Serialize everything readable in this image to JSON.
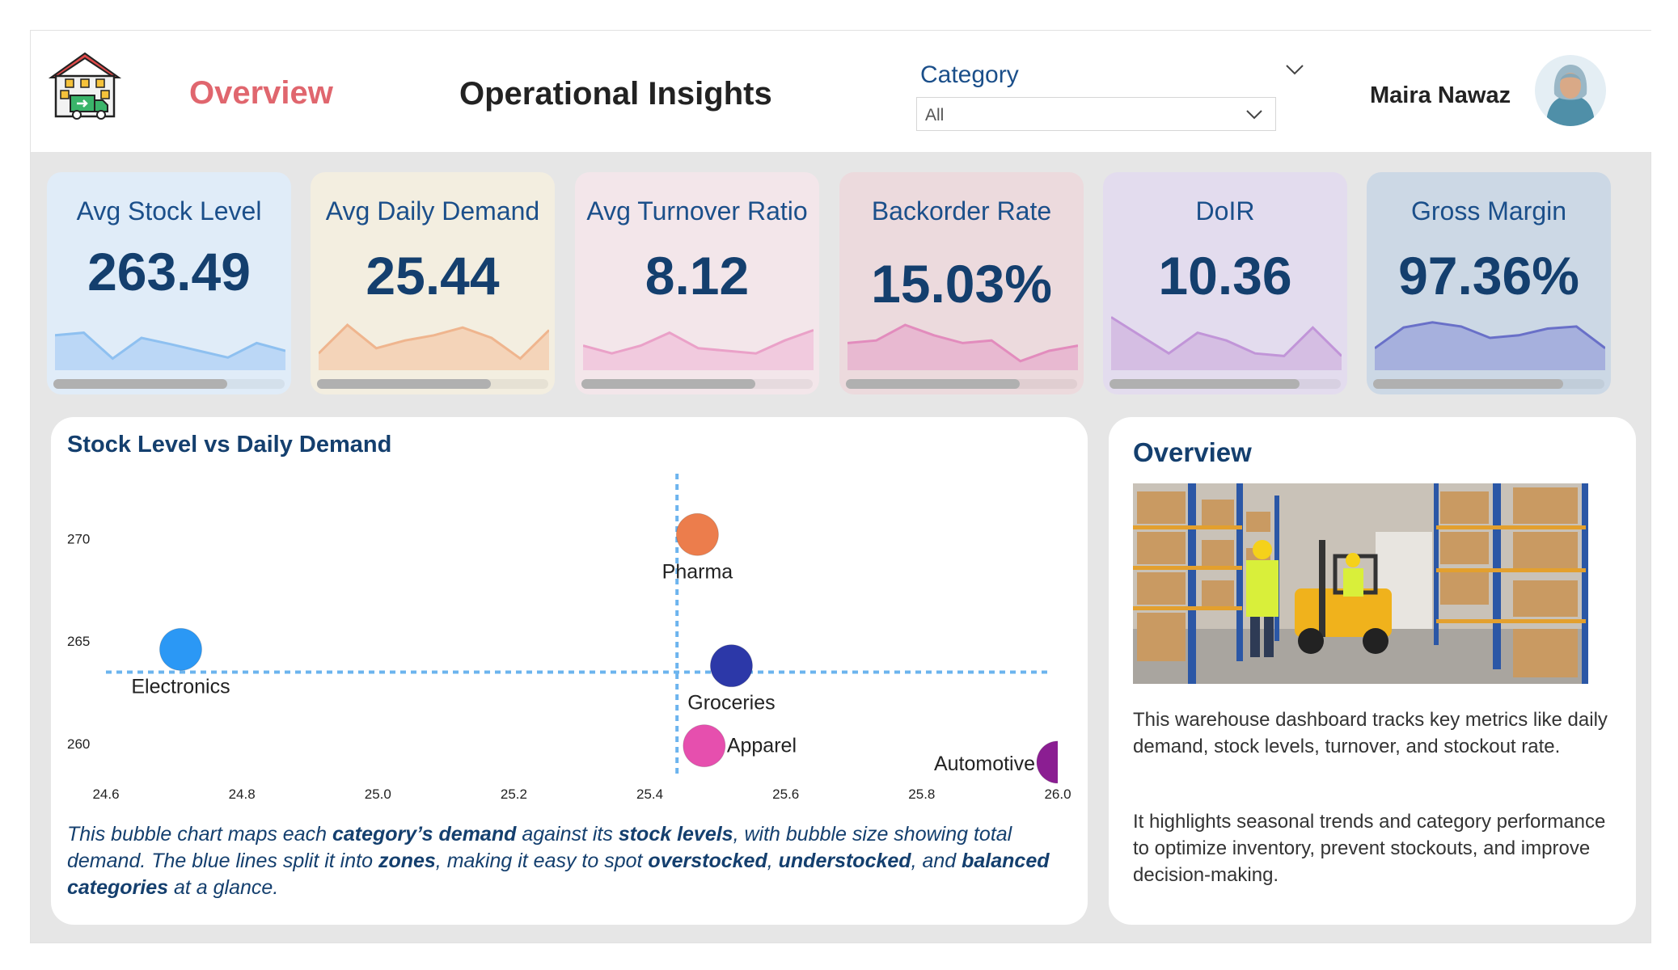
{
  "header": {
    "nav_overview": "Overview",
    "title": "Operational Insights",
    "category_label": "Category",
    "category_selected": "All",
    "user_name": "Maira Nawaz"
  },
  "colors": {
    "accent_nav": "#e0666e",
    "title_blue": "#143f6e"
  },
  "kpis": [
    {
      "title": "Avg Stock Level",
      "value": "263.49",
      "bg": "#e0ecf8",
      "spark_fill": "#b4d4f6",
      "spark_stroke": "#8ec0f0",
      "trend": [
        0.55,
        0.6,
        0.1,
        0.5,
        0.38,
        0.25,
        0.12,
        0.4,
        0.25
      ],
      "scroll_fraction": 0.75
    },
    {
      "title": "Avg Daily Demand",
      "value": "25.44",
      "bg": "#f3eee0",
      "spark_fill": "#f3cfb2",
      "spark_stroke": "#efb58e",
      "trend": [
        0.2,
        0.75,
        0.3,
        0.45,
        0.55,
        0.7,
        0.5,
        0.1,
        0.65
      ],
      "scroll_fraction": 0.75
    },
    {
      "title": "Avg Turnover Ratio",
      "value": "8.12",
      "bg": "#f3e6ea",
      "spark_fill": "#f0c4dc",
      "spark_stroke": "#eaa1c8",
      "trend": [
        0.35,
        0.2,
        0.35,
        0.6,
        0.3,
        0.25,
        0.2,
        0.45,
        0.65
      ],
      "scroll_fraction": 0.75
    },
    {
      "title": "Backorder Rate",
      "value": "15.03%",
      "bg": "#ecdadd",
      "spark_fill": "#e7b3cf",
      "spark_stroke": "#e28cbd",
      "trend": [
        0.4,
        0.45,
        0.75,
        0.55,
        0.4,
        0.45,
        0.05,
        0.25,
        0.35
      ],
      "scroll_fraction": 0.75
    },
    {
      "title": "DoIR",
      "value": "10.36",
      "bg": "#e3dcee",
      "spark_fill": "#d2b8e0",
      "spark_stroke": "#c195d8",
      "trend": [
        0.9,
        0.55,
        0.2,
        0.6,
        0.45,
        0.2,
        0.15,
        0.7,
        0.15
      ],
      "scroll_fraction": 0.82
    },
    {
      "title": "Gross Margin",
      "value": "97.36%",
      "bg": "#ccd8e5",
      "spark_fill": "#9fa9dc",
      "spark_stroke": "#6970c8",
      "trend": [
        0.3,
        0.7,
        0.8,
        0.72,
        0.5,
        0.55,
        0.68,
        0.72,
        0.3
      ],
      "scroll_fraction": 0.82
    }
  ],
  "bubble_chart": {
    "title": "Stock Level vs Daily Demand",
    "description": {
      "p1": "This bubble chart maps each ",
      "b1": "category’s demand",
      "p2": " against its ",
      "b2": "stock levels",
      "p3": ", with bubble size showing total demand. The blue lines split it into ",
      "b3": "zones",
      "p4": ", making it easy to spot ",
      "b4": "overstocked",
      "p5": ", ",
      "b5": "understocked",
      "p6": ", and ",
      "b6": "balanced categories",
      "p7": " at a glance."
    }
  },
  "chart_data": {
    "type": "scatter",
    "title": "Stock Level vs Daily Demand",
    "xlabel": "",
    "ylabel": "",
    "xlim": [
      24.6,
      26.0
    ],
    "ylim": [
      258.9,
      272.3
    ],
    "x_ticks": [
      "24.6",
      "24.8",
      "25.0",
      "25.2",
      "25.4",
      "25.6",
      "25.8",
      "26.0"
    ],
    "y_ticks": [
      "260",
      "265",
      "270"
    ],
    "reference_lines": {
      "x": 25.44,
      "y": 263.49
    },
    "grid": false,
    "legend": "none",
    "series": [
      {
        "name": "Pharma",
        "x": 25.47,
        "y": 270.2,
        "color": "#ec7d4c"
      },
      {
        "name": "Electronics",
        "x": 24.71,
        "y": 264.6,
        "color": "#2b98f5"
      },
      {
        "name": "Groceries",
        "x": 25.52,
        "y": 263.8,
        "color": "#2c38a8"
      },
      {
        "name": "Apparel",
        "x": 25.48,
        "y": 259.9,
        "color": "#e64fae"
      },
      {
        "name": "Automotive",
        "x": 26.0,
        "y": 259.1,
        "color": "#8b1e92"
      }
    ]
  },
  "overview_panel": {
    "title": "Overview",
    "paragraph1": "This warehouse dashboard tracks key metrics like daily demand, stock levels, turnover, and stockout rate.",
    "paragraph2": "It highlights seasonal trends and category performance to optimize inventory, prevent stockouts, and improve decision-making."
  }
}
